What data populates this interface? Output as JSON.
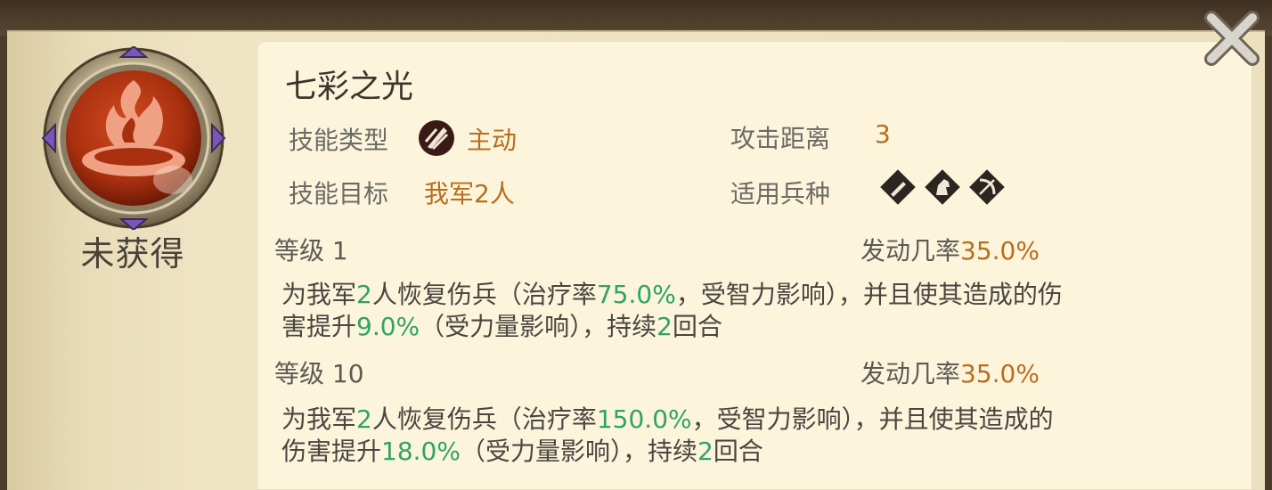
{
  "skill": {
    "name": "七彩之光",
    "status": "未获得",
    "type_label": "技能类型",
    "type_value": "主动",
    "type_icon": "active-skill-icon",
    "target_label": "技能目标",
    "target_value": "我军2人",
    "range_label": "攻击距离",
    "range_value": "3",
    "troops_label": "适用兵种",
    "troop_icons": [
      "infantry-icon",
      "cavalry-icon",
      "archer-icon"
    ]
  },
  "levels": [
    {
      "level_label": "等级",
      "level": "1",
      "rate_label": "发动几率",
      "rate": "35.0%",
      "desc": {
        "p1": "为我军",
        "n1": "2",
        "p2": "人恢复伤兵（治疗率",
        "n2": "75.0%",
        "p3": "，受智力影响），并且使其造成的伤",
        "p4": "害提升",
        "n3": "9.0%",
        "p5": "（受力量影响），持续",
        "n4": "2",
        "p6": "回合"
      }
    },
    {
      "level_label": "等级",
      "level": "10",
      "rate_label": "发动几率",
      "rate": "35.0%",
      "desc": {
        "p1": "为我军",
        "n1": "2",
        "p2": "人恢复伤兵（治疗率",
        "n2": "150.0%",
        "p3": "，受智力影响），并且使其造成的",
        "p4": "伤害提升",
        "n3": "18.0%",
        "p5": "（受力量影响），持续",
        "n4": "2",
        "p6": "回合"
      }
    }
  ],
  "colors": {
    "highlight": "#2fa367",
    "value": "#b86d1e",
    "card_bg": "#fcf5dc"
  }
}
